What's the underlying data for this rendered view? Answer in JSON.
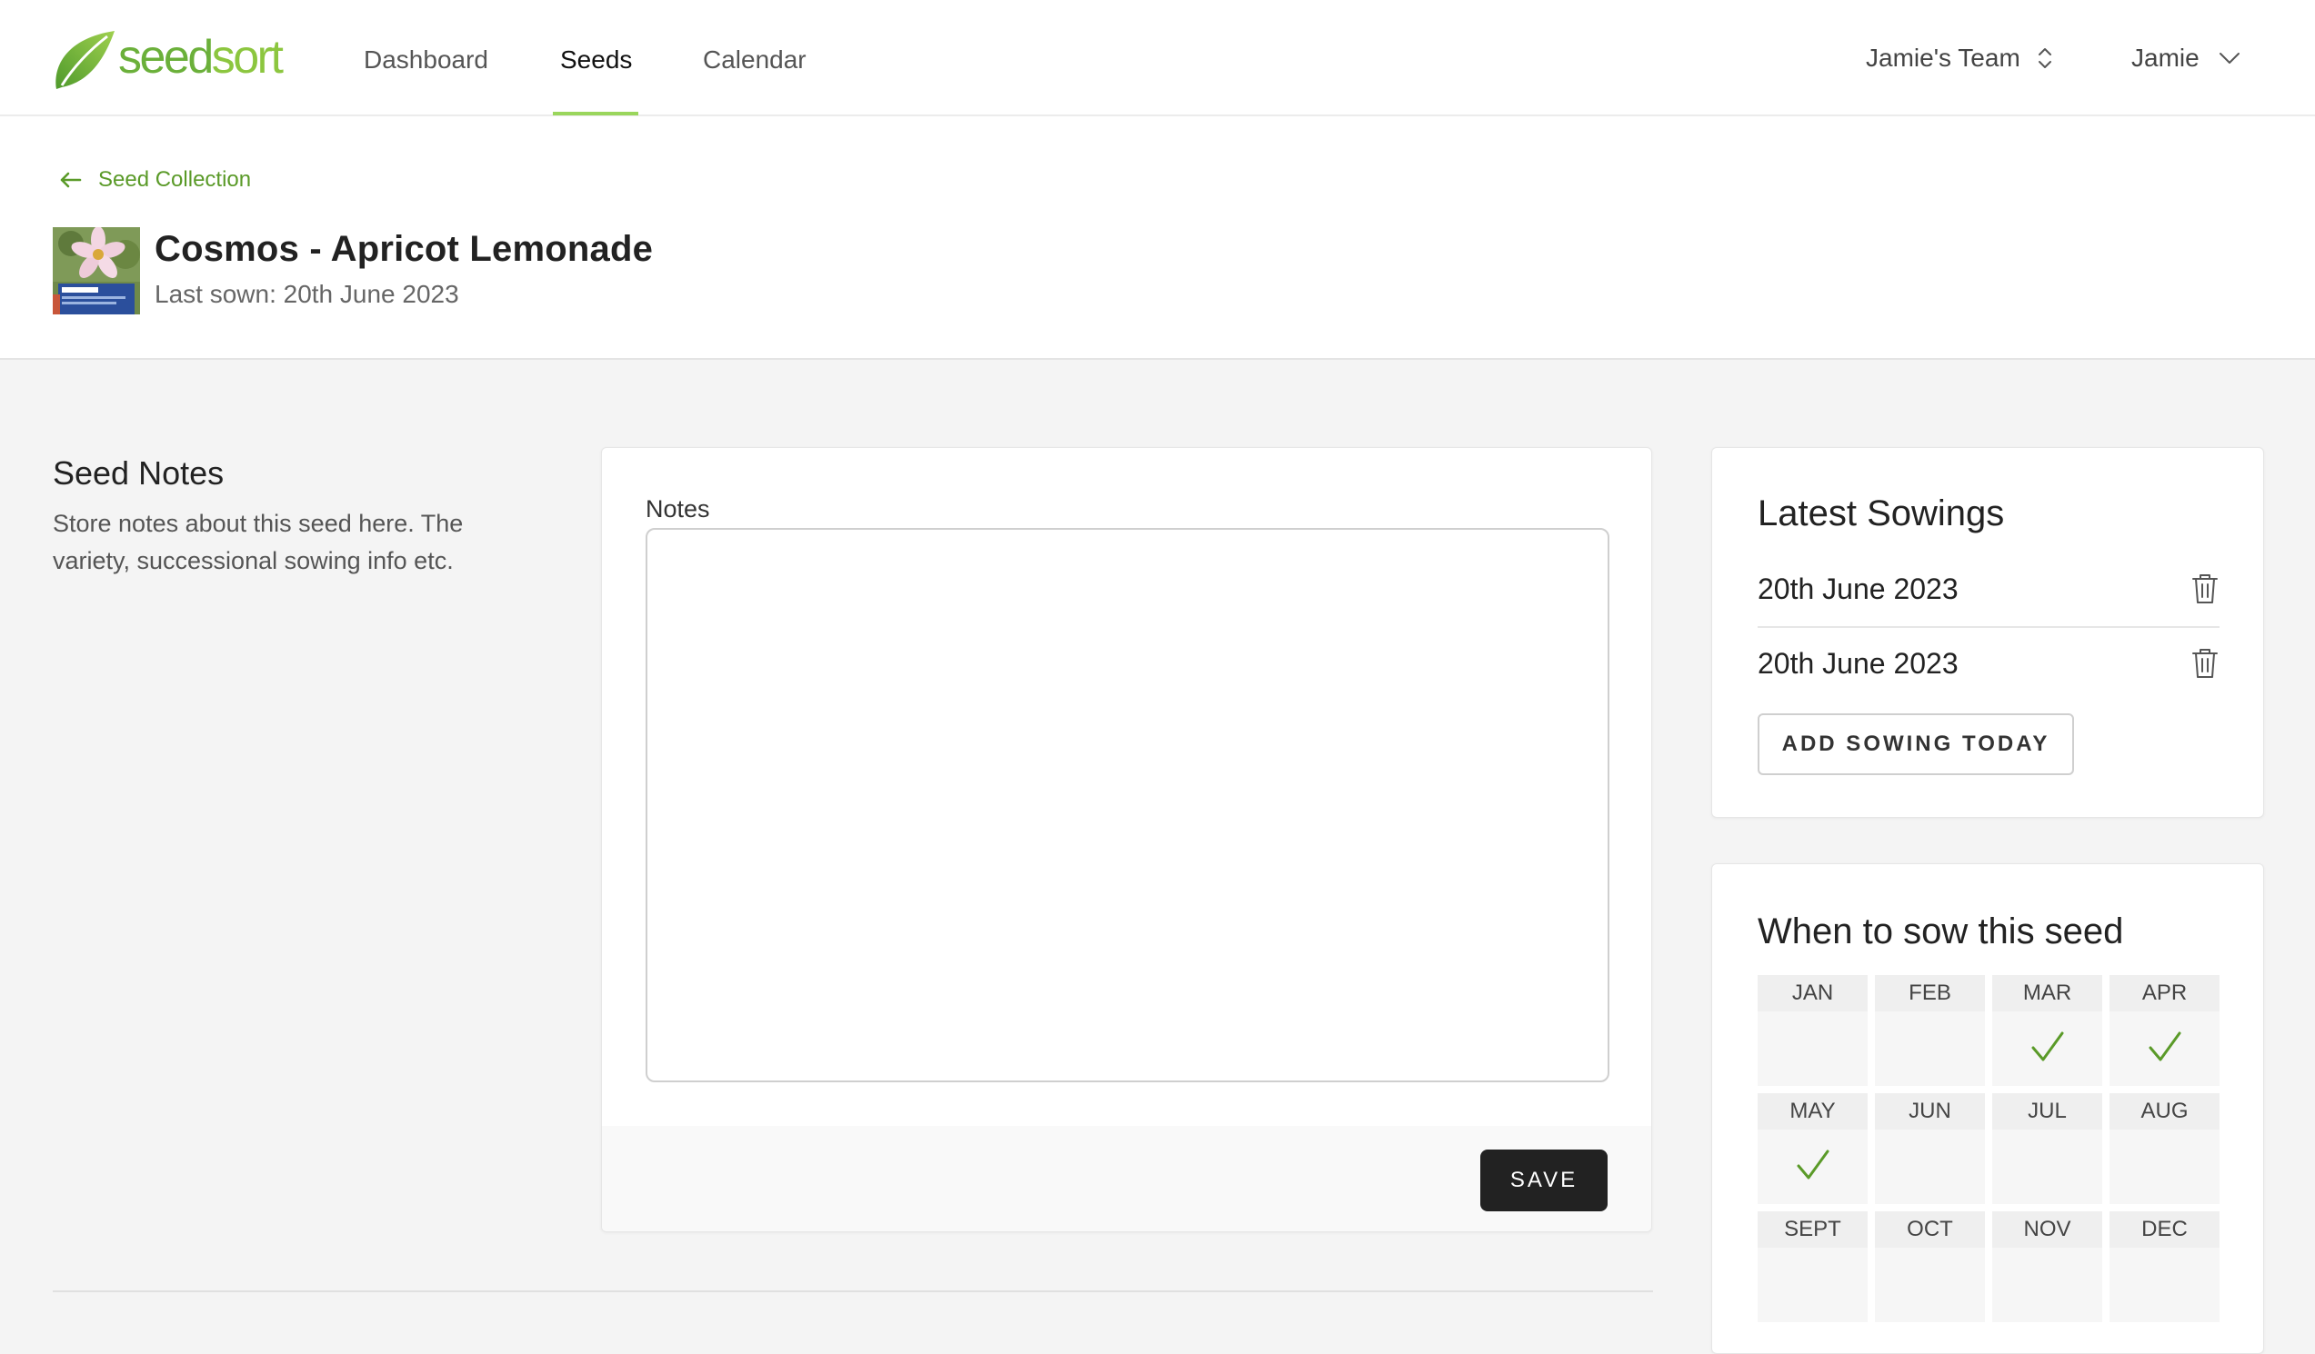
{
  "brand": {
    "name_part1": "seed",
    "name_part2": "sort",
    "color_primary": "#6bb03a",
    "color_accent": "#8cc63f"
  },
  "nav": {
    "items": [
      {
        "label": "Dashboard",
        "active": false
      },
      {
        "label": "Seeds",
        "active": true
      },
      {
        "label": "Calendar",
        "active": false
      }
    ],
    "team": "Jamie's Team",
    "user": "Jamie"
  },
  "breadcrumb": {
    "label": "Seed Collection",
    "icon": "arrow-left-icon"
  },
  "seed": {
    "title": "Cosmos - Apricot Lemonade",
    "last_sown": "Last sown: 20th June 2023"
  },
  "notes_section": {
    "heading": "Seed Notes",
    "description": "Store notes about this seed here. The variety, successional sowing info etc.",
    "field_label": "Notes",
    "field_value": "",
    "save_label": "SAVE"
  },
  "latest_sowings": {
    "title": "Latest Sowings",
    "items": [
      {
        "date": "20th June 2023",
        "icon": "trash-icon"
      },
      {
        "date": "20th June 2023",
        "icon": "trash-icon"
      }
    ],
    "add_label": "ADD SOWING TODAY"
  },
  "sow_calendar": {
    "title": "When to sow this seed",
    "check_color": "#5a9a28",
    "months": [
      {
        "label": "JAN",
        "sow": false
      },
      {
        "label": "FEB",
        "sow": false
      },
      {
        "label": "MAR",
        "sow": true
      },
      {
        "label": "APR",
        "sow": true
      },
      {
        "label": "MAY",
        "sow": true
      },
      {
        "label": "JUN",
        "sow": false
      },
      {
        "label": "JUL",
        "sow": false
      },
      {
        "label": "AUG",
        "sow": false
      },
      {
        "label": "SEPT",
        "sow": false
      },
      {
        "label": "OCT",
        "sow": false
      },
      {
        "label": "NOV",
        "sow": false
      },
      {
        "label": "DEC",
        "sow": false
      }
    ]
  }
}
